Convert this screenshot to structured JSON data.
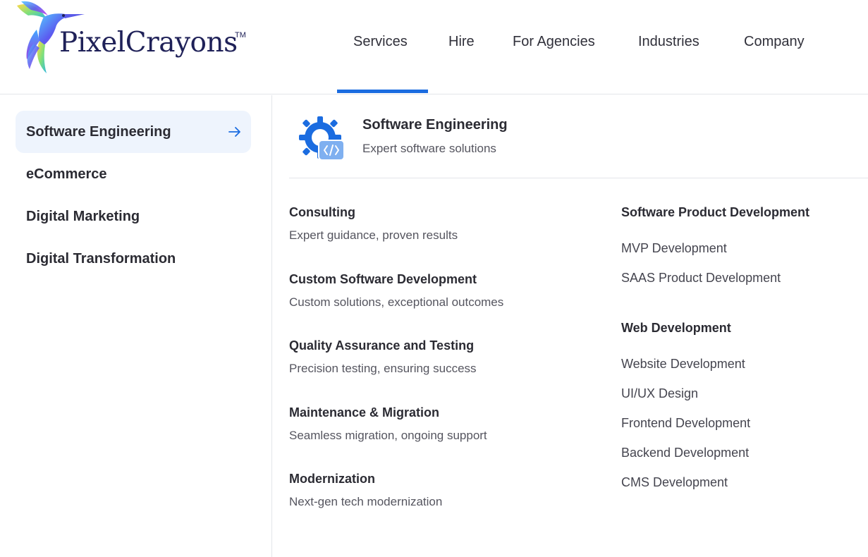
{
  "brand": {
    "name": "PixelCrayons",
    "trademark": "TM"
  },
  "nav": {
    "items": [
      "Services",
      "Hire",
      "For Agencies",
      "Industries",
      "Company"
    ],
    "active": "Services",
    "accent_color": "#1b6ce0"
  },
  "sidebar": {
    "items": [
      {
        "label": "Software Engineering",
        "active": true
      },
      {
        "label": "eCommerce",
        "active": false
      },
      {
        "label": "Digital Marketing",
        "active": false
      },
      {
        "label": "Digital Transformation",
        "active": false
      }
    ],
    "active_bg": "#eef4fd"
  },
  "panel": {
    "icon": "gear-code-icon",
    "title": "Software Engineering",
    "subtitle": "Expert software solutions",
    "services": [
      {
        "title": "Consulting",
        "desc": "Expert guidance, proven results"
      },
      {
        "title": "Custom Software Development",
        "desc": "Custom solutions, exceptional outcomes"
      },
      {
        "title": "Quality Assurance and Testing",
        "desc": "Precision testing, ensuring success"
      },
      {
        "title": "Maintenance & Migration",
        "desc": "Seamless migration, ongoing support"
      },
      {
        "title": "Modernization",
        "desc": "Next-gen tech modernization"
      }
    ],
    "groups": [
      {
        "title": "Software Product Development",
        "links": [
          "MVP Development",
          "SAAS Product Development"
        ]
      },
      {
        "title": "Web Development",
        "links": [
          "Website Development",
          "UI/UX Design",
          "Frontend Development",
          "Backend Development",
          "CMS Development"
        ]
      }
    ]
  }
}
